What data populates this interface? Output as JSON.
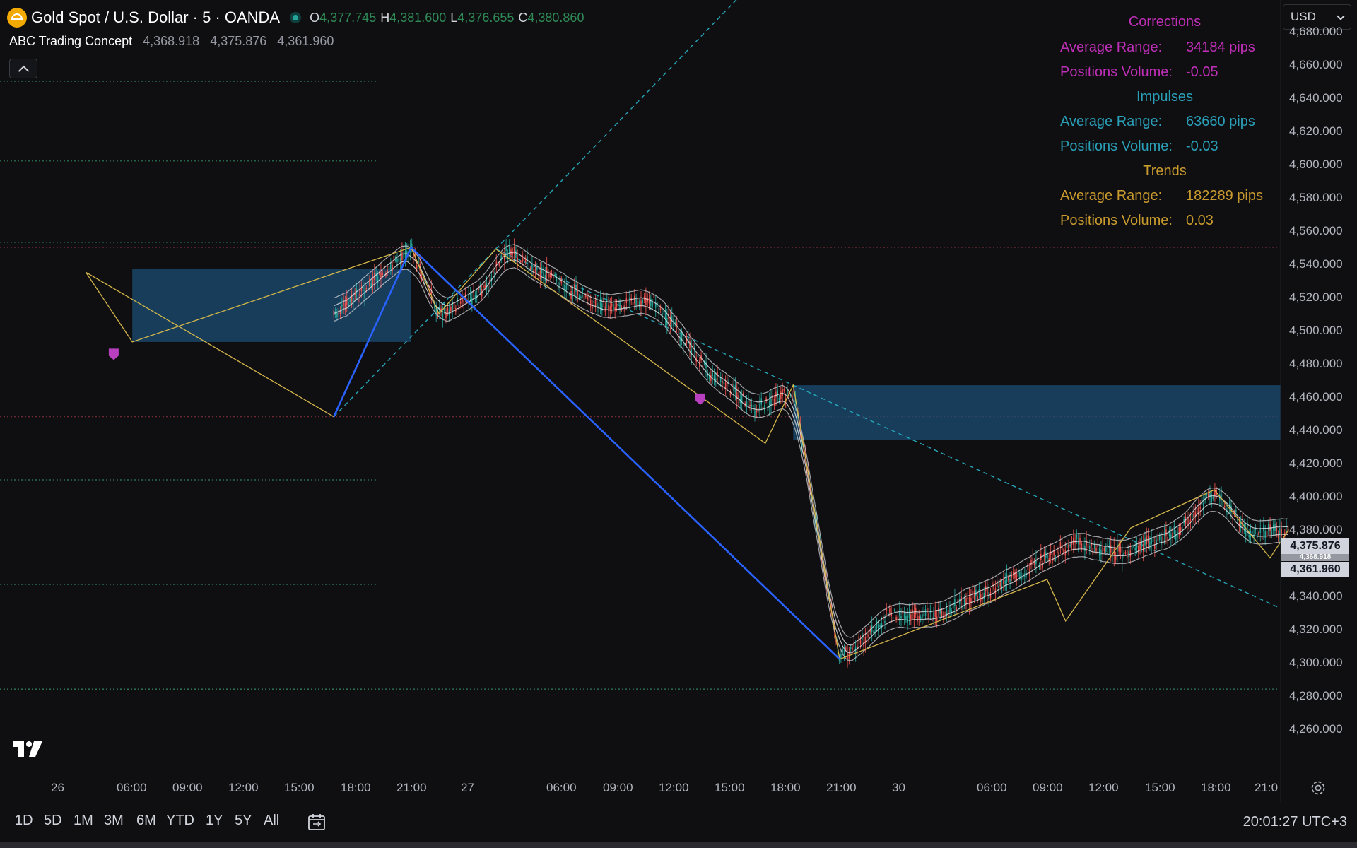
{
  "header": {
    "symbol_title": "Gold Spot / U.S. Dollar · 5 · OANDA",
    "ohlc": [
      {
        "key": "O",
        "value": "4,377.745"
      },
      {
        "key": "H",
        "value": "4,381.600"
      },
      {
        "key": "L",
        "value": "4,376.655"
      },
      {
        "key": "C",
        "value": "4,380.860"
      }
    ],
    "currency_selector": "USD"
  },
  "indicator": {
    "name": "ABC Trading Concept",
    "values": [
      "4,368.918",
      "4,375.876",
      "4,361.960"
    ]
  },
  "stats_panel": {
    "corrections": {
      "title": "Corrections",
      "avg_label": "Average Range:",
      "avg_value": "34184 pips",
      "vol_label": "Positions Volume:",
      "vol_value": "-0.05",
      "color": "#c02fb8"
    },
    "impulses": {
      "title": "Impulses",
      "avg_label": "Average Range:",
      "avg_value": "63660 pips",
      "vol_label": "Positions Volume:",
      "vol_value": "-0.03",
      "color": "#2a9fb8"
    },
    "trends": {
      "title": "Trends",
      "avg_label": "Average Range:",
      "avg_value": "182289 pips",
      "vol_label": "Positions Volume:",
      "vol_value": "0.03",
      "color": "#c99a2e"
    }
  },
  "price_axis": {
    "labels": [
      "4,680.000",
      "4,660.000",
      "4,640.000",
      "4,620.000",
      "4,600.000",
      "4,580.000",
      "4,560.000",
      "4,540.000",
      "4,520.000",
      "4,500.000",
      "4,480.000",
      "4,460.000",
      "4,440.000",
      "4,420.000",
      "4,400.000",
      "4,380.000",
      "4,340.000",
      "4,320.000",
      "4,300.000",
      "4,280.000",
      "4,260.000"
    ],
    "tags": [
      "4,375.876",
      "4,368.918",
      "4,361.960"
    ]
  },
  "time_axis": {
    "labels": [
      "26",
      "06:00",
      "09:00",
      "12:00",
      "15:00",
      "18:00",
      "21:00",
      "27",
      "06:00",
      "09:00",
      "12:00",
      "15:00",
      "18:00",
      "21:00",
      "30",
      "06:00",
      "09:00",
      "12:00",
      "15:00",
      "18:00",
      "21:0"
    ]
  },
  "bottom_bar": {
    "ranges": [
      "1D",
      "5D",
      "1M",
      "3M",
      "6M",
      "YTD",
      "1Y",
      "5Y",
      "All"
    ],
    "clock": "20:01:27 UTC+3"
  },
  "colors": {
    "background": "#0f0f11",
    "trend_line": "#2962ff",
    "zigzag": "#d4b64a",
    "zone": "#1b4e73",
    "guide_dashed": "#26a6b8",
    "level_green": "#2e7d5a",
    "level_red": "#7a2e3a",
    "marker": "#b83fc0",
    "candle_up": "#26a69a",
    "candle_down": "#ef5350"
  },
  "chart_data": {
    "type": "candlestick",
    "symbol": "XAUUSD",
    "timeframe": "5",
    "y_range": [
      4250,
      4690
    ],
    "x_ticks": [
      "26",
      "06:00",
      "09:00",
      "12:00",
      "15:00",
      "18:00",
      "21:00",
      "27",
      "06:00",
      "09:00",
      "12:00",
      "15:00",
      "18:00",
      "21:00",
      "30",
      "06:00",
      "09:00",
      "12:00",
      "15:00",
      "18:00",
      "21:0"
    ],
    "price_path": [
      {
        "time": "25 21:00",
        "price": 4448
      },
      {
        "time": "26 01:30",
        "price": 4535
      },
      {
        "time": "26 04:00",
        "price": 4495
      },
      {
        "time": "26 06:30",
        "price": 4505
      },
      {
        "time": "26 12:00",
        "price": 4518
      },
      {
        "time": "26 15:00",
        "price": 4510
      },
      {
        "time": "26 19:00",
        "price": 4549
      },
      {
        "time": "26 20:30",
        "price": 4510
      },
      {
        "time": "26 23:00",
        "price": 4524
      },
      {
        "time": "27 02:00",
        "price": 4548
      },
      {
        "time": "27 07:00",
        "price": 4515
      },
      {
        "time": "27 10:00",
        "price": 4518
      },
      {
        "time": "27 13:00",
        "price": 4475
      },
      {
        "time": "27 15:30",
        "price": 4453
      },
      {
        "time": "27 17:30",
        "price": 4463
      },
      {
        "time": "27 18:30",
        "price": 4400
      },
      {
        "time": "27 20:00",
        "price": 4303
      },
      {
        "time": "27 22:00",
        "price": 4320
      },
      {
        "time": "28 00:30",
        "price": 4330
      },
      {
        "time": "28 03:00",
        "price": 4328
      },
      {
        "time": "30 06:00",
        "price": 4349
      },
      {
        "time": "30 09:30",
        "price": 4373
      },
      {
        "time": "30 12:00",
        "price": 4365
      },
      {
        "time": "30 15:00",
        "price": 4378
      },
      {
        "time": "30 17:00",
        "price": 4403
      },
      {
        "time": "30 19:00",
        "price": 4377
      },
      {
        "time": "30 21:00",
        "price": 4380
      }
    ],
    "zigzag": [
      {
        "time": "25 21:00",
        "price": 4448
      },
      {
        "time": "26 01:30",
        "price": 4535
      },
      {
        "time": "26 04:00",
        "price": 4493
      },
      {
        "time": "26 19:00",
        "price": 4550
      },
      {
        "time": "26 20:30",
        "price": 4510
      },
      {
        "time": "27 01:30",
        "price": 4549
      },
      {
        "time": "27 16:00",
        "price": 4432
      },
      {
        "time": "27 17:30",
        "price": 4467
      },
      {
        "time": "27 20:00",
        "price": 4302
      },
      {
        "time": "30 08:00",
        "price": 4350
      },
      {
        "time": "30 09:00",
        "price": 4325
      },
      {
        "time": "30 12:30",
        "price": 4381
      },
      {
        "time": "30 17:00",
        "price": 4404
      },
      {
        "time": "30 20:00",
        "price": 4363
      },
      {
        "time": "30 21:00",
        "price": 4380
      }
    ],
    "trend_lines": [
      {
        "from": {
          "time": "25 21:00",
          "price": 4448
        },
        "to": {
          "time": "26 19:00",
          "price": 4550
        }
      },
      {
        "from": {
          "time": "26 19:00",
          "price": 4550
        },
        "to": {
          "time": "27 20:00",
          "price": 4302
        }
      }
    ],
    "zones": [
      {
        "time_from": "26 04:00",
        "time_to": "26 19:00",
        "price_top": 4537,
        "price_bottom": 4493
      },
      {
        "time_from": "27 17:30",
        "time_to": "30 21:30",
        "price_top": 4467,
        "price_bottom": 4434
      }
    ],
    "markers": [
      {
        "time": "26 03:00",
        "price": 4486
      },
      {
        "time": "27 12:30",
        "price": 4459
      }
    ],
    "levels": [
      {
        "price": 4650,
        "style": "dotted",
        "color": "green"
      },
      {
        "price": 4602,
        "style": "dotted",
        "color": "green"
      },
      {
        "price": 4553,
        "style": "dotted",
        "color": "green"
      },
      {
        "price": 4550,
        "style": "dotted",
        "color": "red"
      },
      {
        "price": 4448,
        "style": "dotted",
        "color": "red"
      },
      {
        "price": 4410,
        "style": "dotted",
        "color": "green"
      },
      {
        "price": 4347,
        "style": "dotted",
        "color": "green"
      },
      {
        "price": 4284,
        "style": "dotted",
        "color": "green"
      }
    ]
  }
}
